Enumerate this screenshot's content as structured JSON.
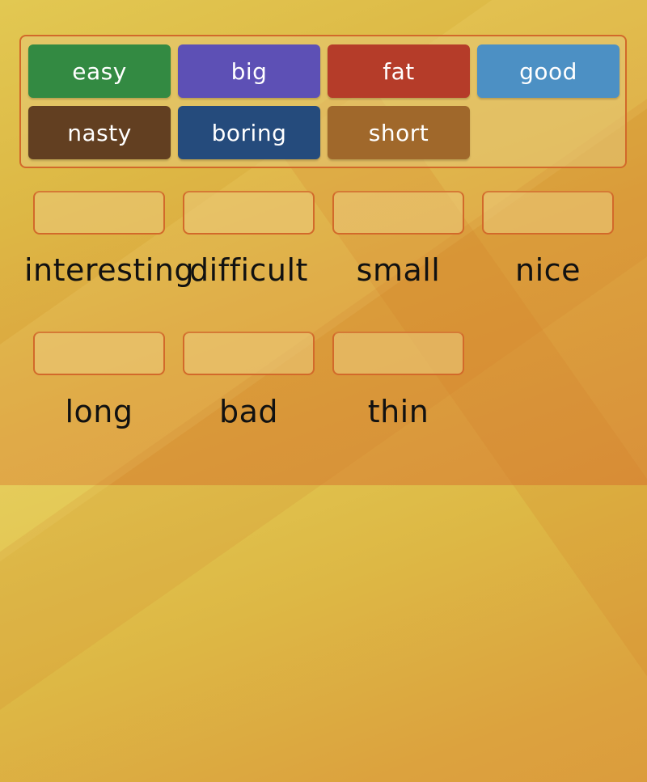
{
  "colors": {
    "tile_easy": "#338a42",
    "tile_big": "#5d50b5",
    "tile_fat": "#b53c29",
    "tile_good": "#4c90c4",
    "tile_nasty": "#623f21",
    "tile_boring": "#254b7c",
    "tile_short": "#a0682b",
    "slot_border": "#d2692a"
  },
  "word_bank": {
    "tiles": [
      {
        "label": "easy"
      },
      {
        "label": "big"
      },
      {
        "label": "fat"
      },
      {
        "label": "good"
      },
      {
        "label": "nasty"
      },
      {
        "label": "boring"
      },
      {
        "label": "short"
      }
    ]
  },
  "targets": [
    {
      "label": "interesting"
    },
    {
      "label": "difficult"
    },
    {
      "label": "small"
    },
    {
      "label": "nice"
    },
    {
      "label": "long"
    },
    {
      "label": "bad"
    },
    {
      "label": "thin"
    }
  ]
}
